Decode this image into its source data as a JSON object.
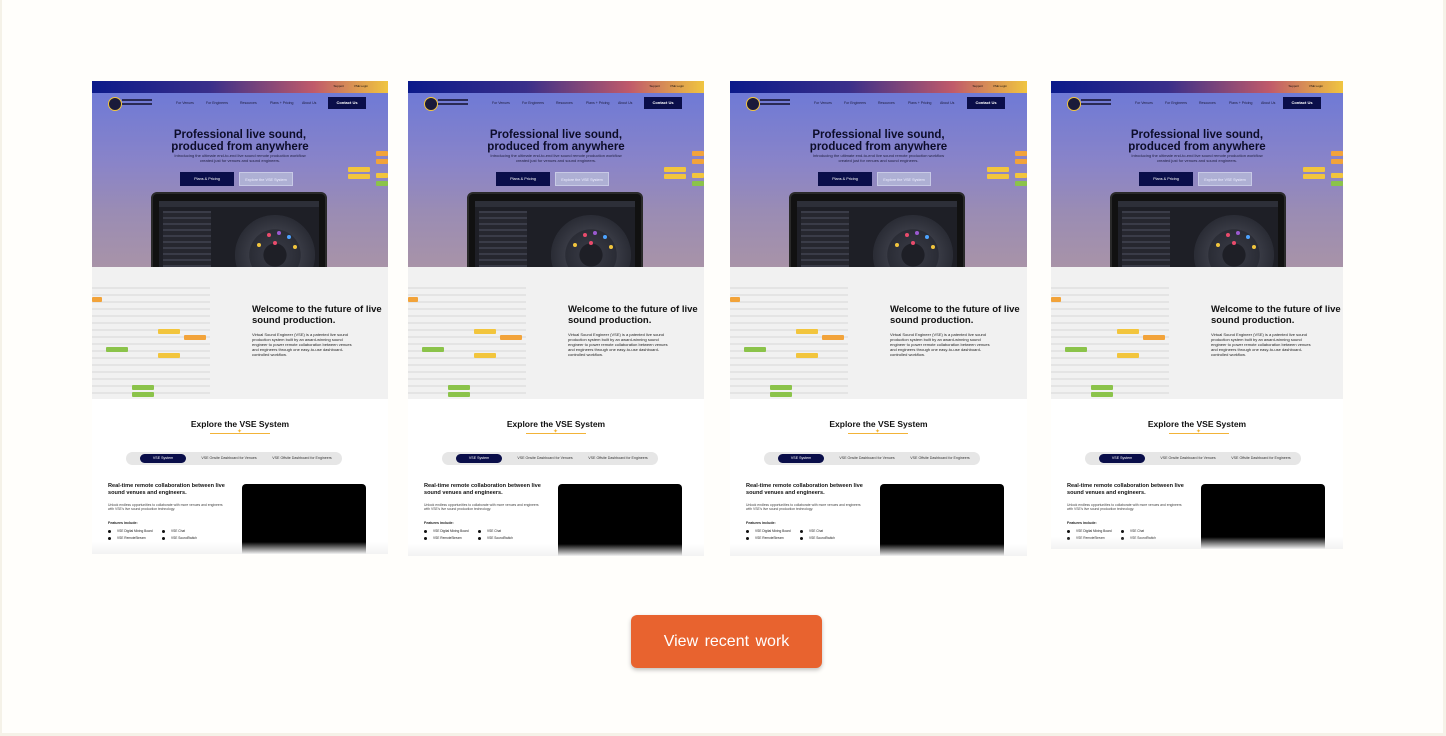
{
  "cards": [
    {
      "topbar_links": [
        "Support",
        "VSE Login"
      ],
      "nav": [
        "For Venues",
        "For Engineers",
        "Resources",
        "Plans + Pricing",
        "About Us"
      ],
      "nav_cta": "Contact Us",
      "hero_title": "Professional live sound, produced from anywhere",
      "hero_sub": "Introducing the ultimate end-to-end live sound remote production workflow created just for venues and sound engineers.",
      "hero_btn_primary": "Plans & Pricing",
      "hero_btn_secondary": "Explore the VSE System",
      "welcome_title": "Welcome to the future of live sound production.",
      "welcome_body": "Virtual Sound Engineer (VSE) is a patented live sound production system built by an award-winning sound engineer to power remote collaboration between venues and engineers through one easy-to-use dashboard-controlled workflow.",
      "explore_title": "Explore the VSE System",
      "tabs": [
        "VSE System",
        "VSE Onsite Dashboard for Venues",
        "VSE Offsite Dashboard for Engineers"
      ],
      "collab_title": "Real-time remote collaboration between live sound venues and engineers.",
      "collab_body": "Unlock endless opportunities to collaborate with more venues and engineers with VSE's live sound production technology.",
      "features_label": "Features include:",
      "features": [
        "VSE Digital Mixing Board",
        "VSE Chat",
        "VSE RemoteStream",
        "VSE SoundSwitch"
      ]
    },
    {
      "topbar_links": [
        "Support",
        "VSE Login"
      ],
      "nav": [
        "For Venues",
        "For Engineers",
        "Resources",
        "Plans + Pricing",
        "About Us"
      ],
      "nav_cta": "Contact Us",
      "hero_title": "Professional live sound, produced from anywhere",
      "hero_sub": "Introducing the ultimate end-to-end live sound remote production workflow created just for venues and sound engineers.",
      "hero_btn_primary": "Plans & Pricing",
      "hero_btn_secondary": "Explore the VSE System",
      "welcome_title": "Welcome to the future of live sound production.",
      "welcome_body": "Virtual Sound Engineer (VSE) is a patented live sound production system built by an award-winning sound engineer to power remote collaboration between venues and engineers through one easy-to-use dashboard-controlled workflow.",
      "explore_title": "Explore the VSE System",
      "tabs": [
        "VSE System",
        "VSE Onsite Dashboard for Venues",
        "VSE Offsite Dashboard for Engineers"
      ],
      "collab_title": "Real-time remote collaboration between live sound venues and engineers.",
      "collab_body": "Unlock endless opportunities to collaborate with more venues and engineers with VSE's live sound production technology.",
      "features_label": "Features include:",
      "features": [
        "VSE Digital Mixing Board",
        "VSE Chat",
        "VSE RemoteStream",
        "VSE SoundSwitch"
      ]
    },
    {
      "topbar_links": [
        "Support",
        "VSE Login"
      ],
      "nav": [
        "For Venues",
        "For Engineers",
        "Resources",
        "Plans + Pricing",
        "About Us"
      ],
      "nav_cta": "Contact Us",
      "hero_title": "Professional live sound, produced from anywhere",
      "hero_sub": "Introducing the ultimate end-to-end live sound remote production workflow created just for venues and sound engineers.",
      "hero_btn_primary": "Plans & Pricing",
      "hero_btn_secondary": "Explore the VSE System",
      "welcome_title": "Welcome to the future of live sound production.",
      "welcome_body": "Virtual Sound Engineer (VSE) is a patented live sound production system built by an award-winning sound engineer to power remote collaboration between venues and engineers through one easy-to-use dashboard-controlled workflow.",
      "explore_title": "Explore the VSE System",
      "tabs": [
        "VSE System",
        "VSE Onsite Dashboard for Venues",
        "VSE Offsite Dashboard for Engineers"
      ],
      "collab_title": "Real-time remote collaboration between live sound venues and engineers.",
      "collab_body": "Unlock endless opportunities to collaborate with more venues and engineers with VSE's live sound production technology.",
      "features_label": "Features include:",
      "features": [
        "VSE Digital Mixing Board",
        "VSE Chat",
        "VSE RemoteStream",
        "VSE SoundSwitch"
      ]
    },
    {
      "topbar_links": [
        "Support",
        "VSE Login"
      ],
      "nav": [
        "For Venues",
        "For Engineers",
        "Resources",
        "Plans + Pricing",
        "About Us"
      ],
      "nav_cta": "Contact Us",
      "hero_title": "Professional live sound, produced from anywhere",
      "hero_sub": "Introducing the ultimate end-to-end live sound remote production workflow created just for venues and sound engineers.",
      "hero_btn_primary": "Plans & Pricing",
      "hero_btn_secondary": "Explore the VSE System",
      "welcome_title": "Welcome to the future of live sound production.",
      "welcome_body": "Virtual Sound Engineer (VSE) is a patented live sound production system built by an award-winning sound engineer to power remote collaboration between venues and engineers through one easy-to-use dashboard-controlled workflow.",
      "explore_title": "Explore the VSE System",
      "tabs": [
        "VSE System",
        "VSE Onsite Dashboard for Venues",
        "VSE Offsite Dashboard for Engineers"
      ],
      "collab_title": "Real-time remote collaboration between live sound venues and engineers.",
      "collab_body": "Unlock endless opportunities to collaborate with more venues and engineers with VSE's live sound production technology.",
      "features_label": "Features include:",
      "features": [
        "VSE Digital Mixing Board",
        "VSE Chat",
        "VSE RemoteStream",
        "VSE SoundSwitch"
      ]
    }
  ],
  "cta": {
    "label": "View recent work"
  },
  "colors": {
    "accent": "#e8632f",
    "navy": "#0a0e4a",
    "yellow": "#f2c53d",
    "orange": "#f2a33a",
    "green": "#8bc34a",
    "page_bg": "#fffefb"
  }
}
